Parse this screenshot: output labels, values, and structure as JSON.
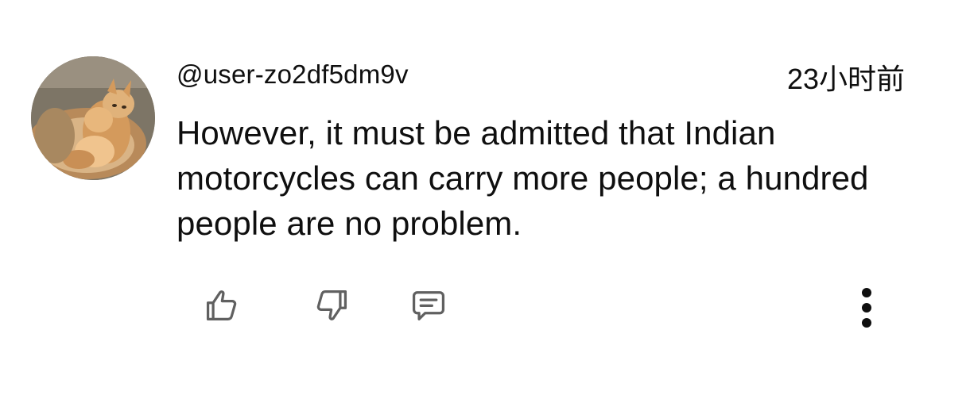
{
  "comment": {
    "author": "@user-zo2df5dm9v",
    "timestamp": "23小时前",
    "text": "However, it must be admitted that Indian motorcycles can carry more people; a hundred people are no problem."
  },
  "avatar": {
    "description_icon": "avatar-cat-photo"
  },
  "actions": {
    "like_icon": "thumbs-up-icon",
    "dislike_icon": "thumbs-down-icon",
    "reply_icon": "comment-reply-icon",
    "more_icon": "more-vertical-icon"
  },
  "colors": {
    "text": "#0f0f0f",
    "icon": "#0f0f0f",
    "background": "#ffffff"
  }
}
